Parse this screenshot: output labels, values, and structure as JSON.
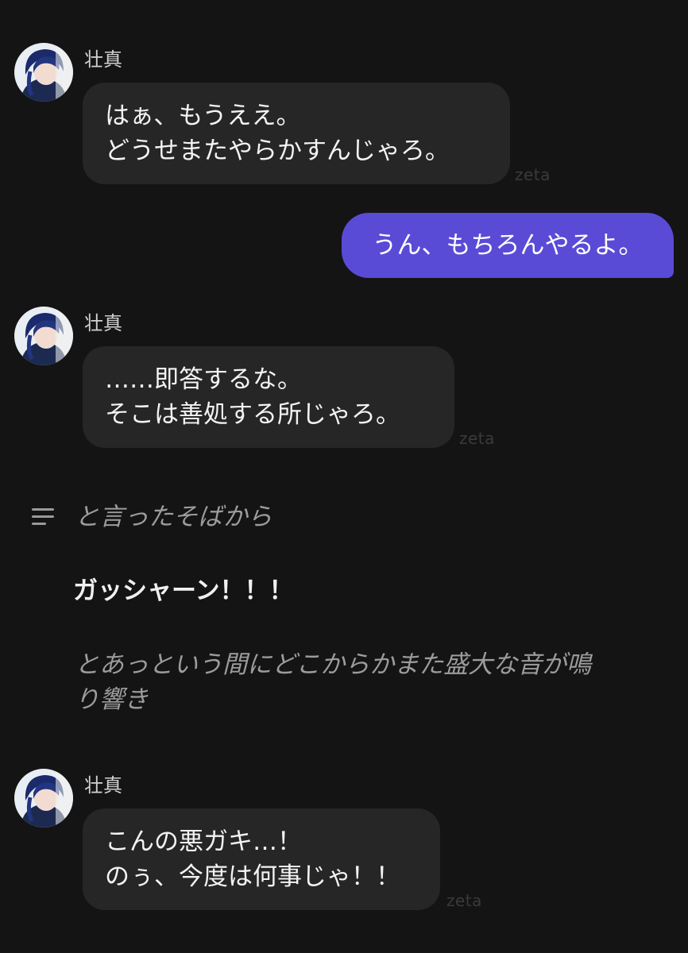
{
  "messages": [
    {
      "sender": "壮真",
      "lines": [
        "はぁ、もうええ。",
        "どうせまたやらかすんじゃろ。"
      ],
      "watermark": "zeta"
    },
    {
      "sender": "壮真",
      "lines": [
        "……即答するな。",
        "そこは善処する所じゃろ。"
      ],
      "watermark": "zeta"
    },
    {
      "sender": "壮真",
      "lines": [
        "こんの悪ガキ…！",
        "のぅ、今度は何事じゃ！！"
      ],
      "watermark": "zeta"
    }
  ],
  "user_message": "うん、もちろんやるよ。",
  "narration": {
    "line1": "と言ったそばから",
    "bold": "ガッシャーン！！！",
    "line2a": "とあっという間にどこからかまた盛大な音が鳴",
    "line2b": "り響き"
  },
  "colors": {
    "background": "#141414",
    "bubble": "#262626",
    "user_bubble": "#5a4bd6",
    "narration_text": "#9c9c9c"
  }
}
